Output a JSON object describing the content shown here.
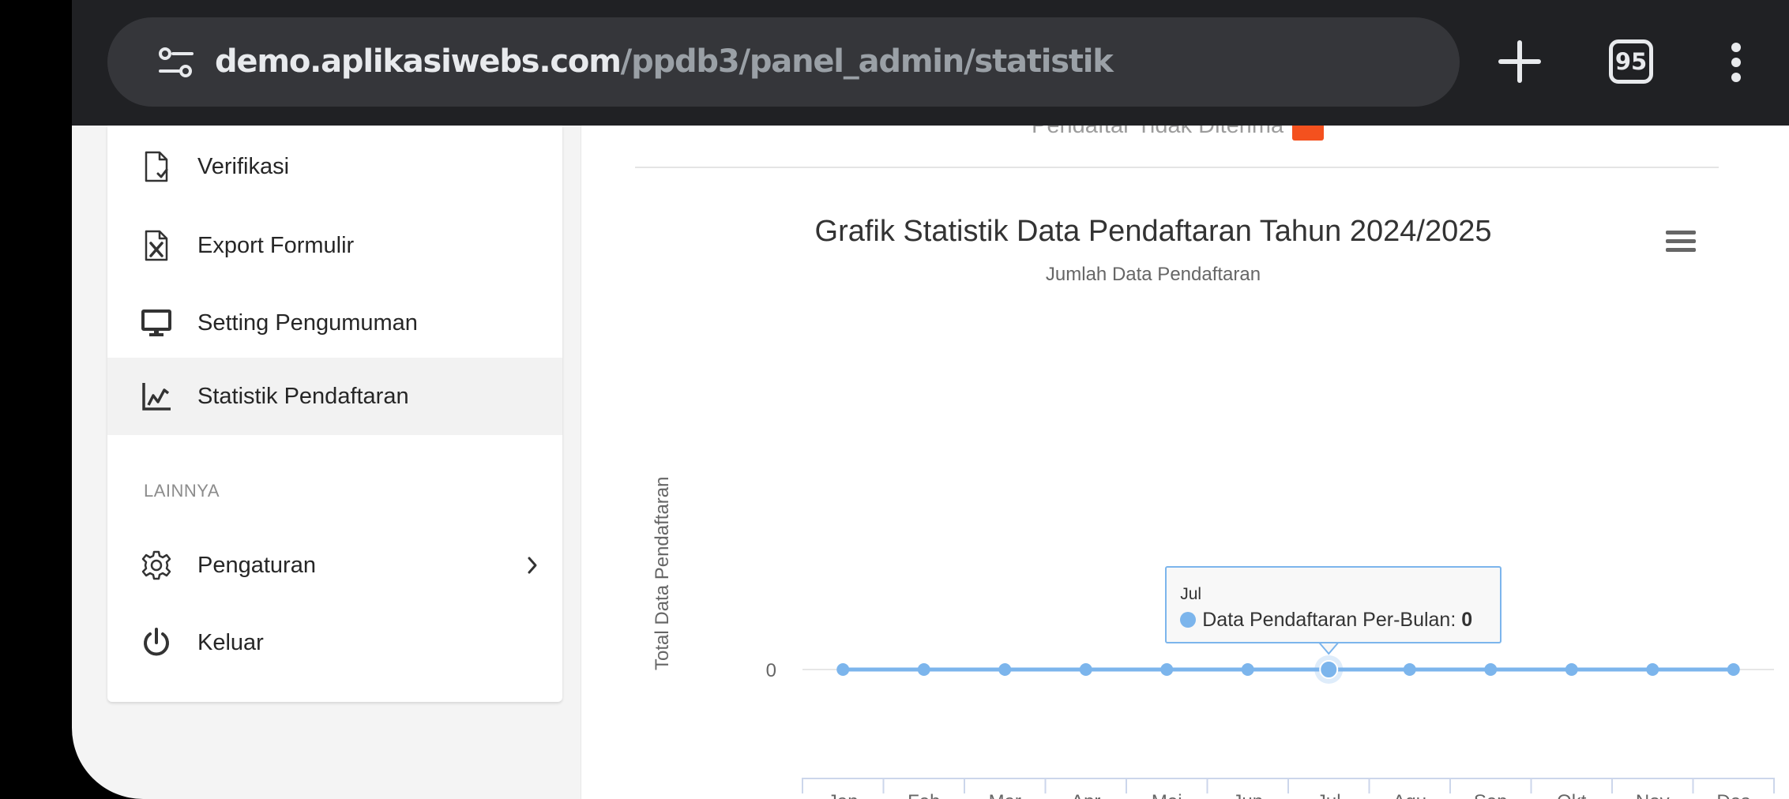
{
  "browser": {
    "url_host": "demo.aplikasiwebs.com",
    "url_path": "/ppdb3/panel_admin/statistik",
    "tab_count": "95",
    "icons": [
      "tune-icon",
      "plus-icon",
      "tabs-icon",
      "kebab-menu-icon"
    ]
  },
  "sidebar": {
    "items": [
      {
        "label": "Verifikasi",
        "icon": "file-check-icon"
      },
      {
        "label": "Export Formulir",
        "icon": "file-excel-icon"
      },
      {
        "label": "Setting Pengumuman",
        "icon": "monitor-icon"
      },
      {
        "label": "Statistik Pendaftaran",
        "icon": "line-chart-icon",
        "active": true
      }
    ],
    "section_label": "LAINNYA",
    "bottom_items": [
      {
        "label": "Pengaturan",
        "icon": "gear-icon",
        "has_submenu": true
      },
      {
        "label": "Keluar",
        "icon": "power-icon"
      }
    ]
  },
  "main": {
    "top_stat_label": "Pendaftar Tidak Diterima",
    "top_stat_badge_color": "#f4511e"
  },
  "chart_data": {
    "type": "line",
    "title": "Grafik Statistik Data Pendaftaran Tahun 2024/2025",
    "subtitle": "Jumlah Data Pendaftaran",
    "ylabel": "Total Data Pendaftaran",
    "xlabel": "",
    "y_ticks": [
      "0"
    ],
    "categories": [
      "Jan",
      "Feb",
      "Mar",
      "Apr",
      "Mei",
      "Jun",
      "Jul",
      "Agu",
      "Sep",
      "Okt",
      "Nov",
      "Des"
    ],
    "series": [
      {
        "name": "Data Pendaftaran Per-Bulan",
        "values": [
          0,
          0,
          0,
          0,
          0,
          0,
          0,
          0,
          0,
          0,
          0,
          0
        ],
        "color": "#7cb5ec"
      }
    ],
    "tooltip": {
      "category": "Jul",
      "series": "Data Pendaftaran Per-Bulan",
      "value": "0"
    },
    "legend": "none",
    "grid": true,
    "menu_icon": "hamburger-menu-icon"
  }
}
